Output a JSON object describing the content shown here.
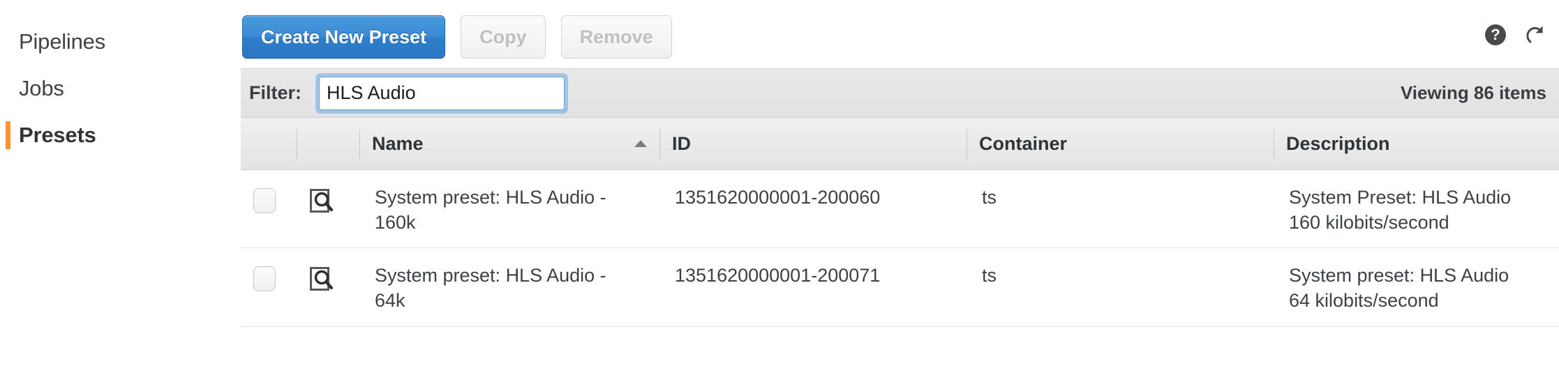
{
  "sidebar": {
    "items": [
      {
        "label": "Pipelines",
        "active": false
      },
      {
        "label": "Jobs",
        "active": false
      },
      {
        "label": "Presets",
        "active": true
      }
    ]
  },
  "toolbar": {
    "create_label": "Create New Preset",
    "copy_label": "Copy",
    "remove_label": "Remove",
    "help_glyph": "?",
    "help_icon": "help-circle-icon",
    "refresh_icon": "refresh-icon"
  },
  "filter": {
    "label": "Filter:",
    "value": "HLS Audio",
    "placeholder": "",
    "viewing_text": "Viewing 86 items"
  },
  "table": {
    "columns": [
      {
        "key": "check",
        "label": ""
      },
      {
        "key": "view",
        "label": ""
      },
      {
        "key": "name",
        "label": "Name",
        "sort": "asc"
      },
      {
        "key": "id",
        "label": "ID"
      },
      {
        "key": "container",
        "label": "Container"
      },
      {
        "key": "description",
        "label": "Description"
      }
    ],
    "rows": [
      {
        "name": "System preset: HLS Audio - 160k",
        "id": "1351620000001-200060",
        "container": "ts",
        "description": "System Preset: HLS Audio 160 kilobits/second",
        "checked": false,
        "view_icon": "document-magnifier-icon"
      },
      {
        "name": "System preset: HLS Audio - 64k",
        "id": "1351620000001-200071",
        "container": "ts",
        "description": "System preset: HLS Audio 64 kilobits/second",
        "checked": false,
        "view_icon": "document-magnifier-icon"
      }
    ]
  },
  "colors": {
    "accent_orange": "#f79334",
    "primary_blue": "#3b8ad4",
    "focus_ring": "#6aa3d8",
    "text": "#3c4146"
  }
}
